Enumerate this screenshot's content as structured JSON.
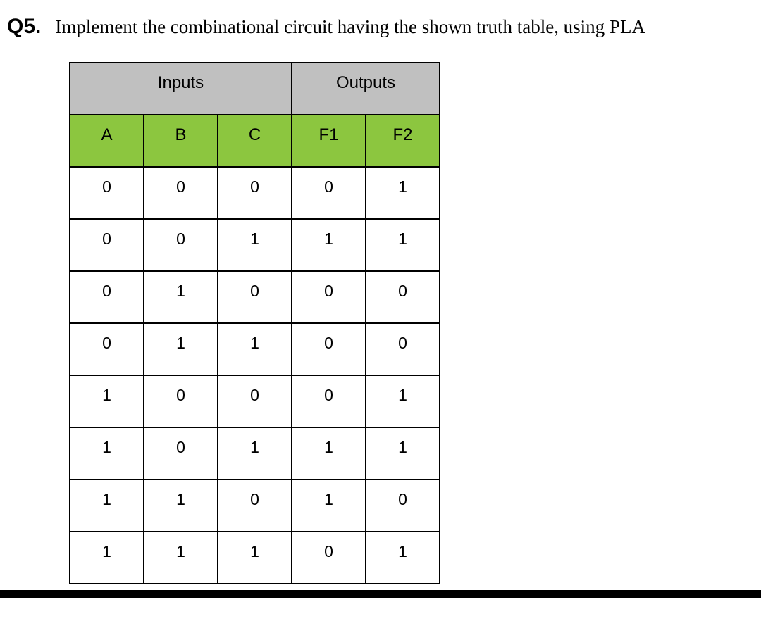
{
  "question": {
    "number": "Q5.",
    "text": "Implement the combinational circuit having the shown truth table, using PLA"
  },
  "table": {
    "group_inputs": "Inputs",
    "group_outputs": "Outputs",
    "headers": {
      "A": "A",
      "B": "B",
      "C": "C",
      "F1": "F1",
      "F2": "F2"
    },
    "rows": [
      {
        "A": "0",
        "B": "0",
        "C": "0",
        "F1": "0",
        "F2": "1"
      },
      {
        "A": "0",
        "B": "0",
        "C": "1",
        "F1": "1",
        "F2": "1"
      },
      {
        "A": "0",
        "B": "1",
        "C": "0",
        "F1": "0",
        "F2": "0"
      },
      {
        "A": "0",
        "B": "1",
        "C": "1",
        "F1": "0",
        "F2": "0"
      },
      {
        "A": "1",
        "B": "0",
        "C": "0",
        "F1": "0",
        "F2": "1"
      },
      {
        "A": "1",
        "B": "0",
        "C": "1",
        "F1": "1",
        "F2": "1"
      },
      {
        "A": "1",
        "B": "1",
        "C": "0",
        "F1": "1",
        "F2": "0"
      },
      {
        "A": "1",
        "B": "1",
        "C": "1",
        "F1": "0",
        "F2": "1"
      }
    ]
  }
}
